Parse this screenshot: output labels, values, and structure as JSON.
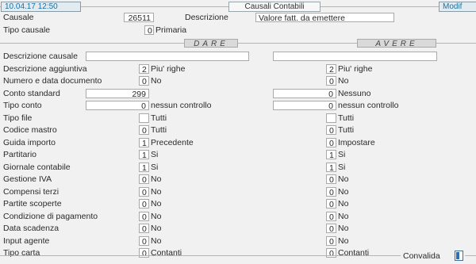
{
  "header": {
    "date_time": "10.04.17 12:50",
    "title": "Causali Contabili",
    "mode": "Modif"
  },
  "top": {
    "causale_label": "Causale",
    "causale_value": "26511",
    "descrizione_label": "Descrizione",
    "descrizione_value": "Valore fatt. da emettere",
    "tipo_causale_label": "Tipo causale",
    "tipo_causale_value": "0",
    "tipo_causale_desc": "Primaria"
  },
  "sections": {
    "dare": "DARE",
    "avere": "AVERE"
  },
  "rows": [
    {
      "label": "Descrizione causale",
      "dare_value": "",
      "dare_desc": "",
      "avere_value": "",
      "avere_desc": ""
    },
    {
      "label": "Descrizione aggiuntiva",
      "dare_value": "2",
      "dare_desc": "Piu' righe",
      "avere_value": "2",
      "avere_desc": "Piu' righe"
    },
    {
      "label": "Numero e data documento",
      "dare_value": "0",
      "dare_desc": "No",
      "avere_value": "0",
      "avere_desc": "No"
    },
    {
      "label": "Conto standard",
      "dare_value": "299",
      "dare_desc": "",
      "avere_value": "0",
      "avere_desc": "Nessuno"
    },
    {
      "label": "Tipo conto",
      "dare_value": "0",
      "dare_desc": "nessun controllo",
      "avere_value": "0",
      "avere_desc": "nessun controllo"
    },
    {
      "label": "Tipo file",
      "dare_value": "",
      "dare_desc": "Tutti",
      "avere_value": "",
      "avere_desc": "Tutti"
    },
    {
      "label": "Codice mastro",
      "dare_value": "0",
      "dare_desc": "Tutti",
      "avere_value": "0",
      "avere_desc": "Tutti"
    },
    {
      "label": "Guida importo",
      "dare_value": "1",
      "dare_desc": "Precedente",
      "avere_value": "0",
      "avere_desc": "Impostare"
    },
    {
      "label": "Partitario",
      "dare_value": "1",
      "dare_desc": "Si",
      "avere_value": "1",
      "avere_desc": "Si"
    },
    {
      "label": "Giornale contabile",
      "dare_value": "1",
      "dare_desc": "Si",
      "avere_value": "1",
      "avere_desc": "Si"
    },
    {
      "label": "Gestione IVA",
      "dare_value": "0",
      "dare_desc": "No",
      "avere_value": "0",
      "avere_desc": "No"
    },
    {
      "label": "Compensi terzi",
      "dare_value": "0",
      "dare_desc": "No",
      "avere_value": "0",
      "avere_desc": "No"
    },
    {
      "label": "Partite scoperte",
      "dare_value": "0",
      "dare_desc": "No",
      "avere_value": "0",
      "avere_desc": "No"
    },
    {
      "label": "Condizione di pagamento",
      "dare_value": "0",
      "dare_desc": "No",
      "avere_value": "0",
      "avere_desc": "No"
    },
    {
      "label": "Data scadenza",
      "dare_value": "0",
      "dare_desc": "No",
      "avere_value": "0",
      "avere_desc": "No"
    },
    {
      "label": "Input agente",
      "dare_value": "0",
      "dare_desc": "No",
      "avere_value": "0",
      "avere_desc": "No"
    },
    {
      "label": "Tipo carta",
      "dare_value": "0",
      "dare_desc": "Contanti",
      "avere_value": "0",
      "avere_desc": "Contanti"
    }
  ],
  "footer": {
    "convalida_label": "Convalida",
    "convalida_icon": "save-icon"
  }
}
